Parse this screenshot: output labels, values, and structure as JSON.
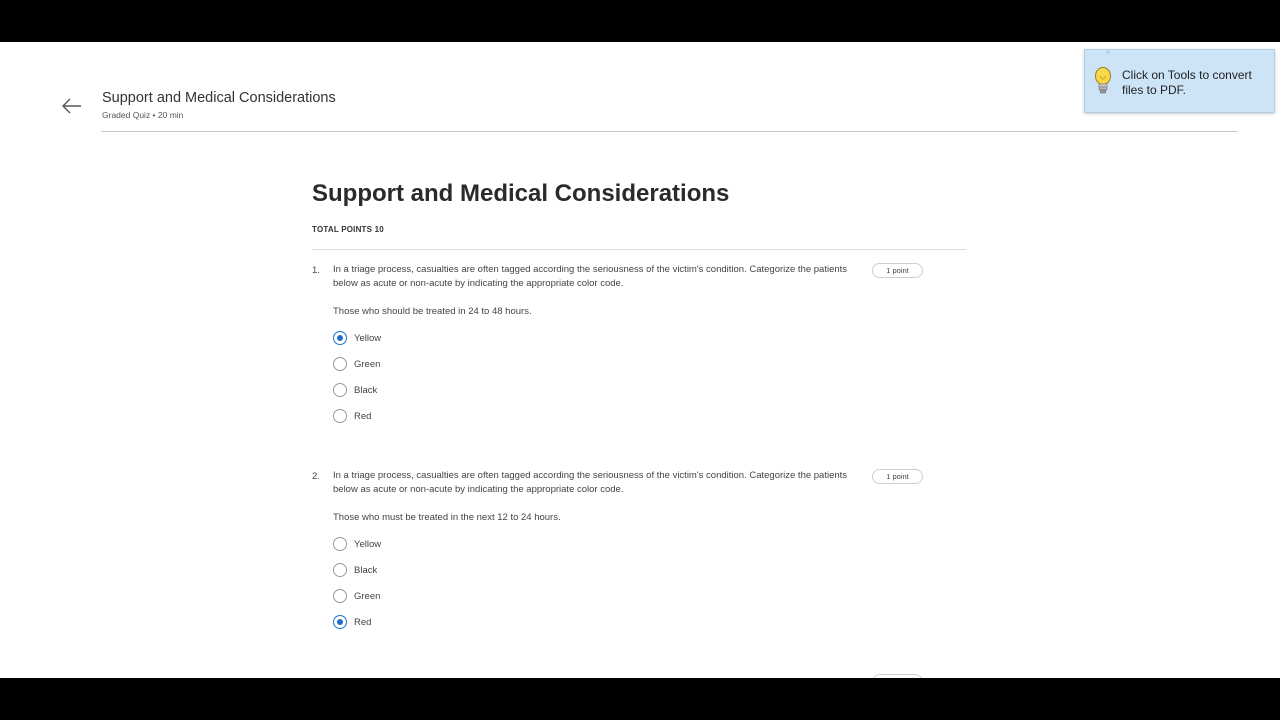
{
  "header": {
    "title": "Support and Medical Considerations",
    "subtitle": "Graded Quiz • 20 min"
  },
  "toast": {
    "message": "Click on Tools to convert files to PDF.",
    "icon": "lightbulb-icon"
  },
  "quiz": {
    "title": "Support and Medical Considerations",
    "total_points": "TOTAL POINTS 10",
    "questions": [
      {
        "number": "1.",
        "text": "In a triage process, casualties are often tagged according the seriousness of the victim's condition. Categorize the patients below as acute or non-acute by indicating the appropriate color code.",
        "points": "1 point",
        "prompt": "Those who should be treated in 24 to 48 hours.",
        "options": [
          {
            "label": "Yellow",
            "selected": true
          },
          {
            "label": "Green",
            "selected": false
          },
          {
            "label": "Black",
            "selected": false
          },
          {
            "label": "Red",
            "selected": false
          }
        ]
      },
      {
        "number": "2.",
        "text": "In a triage process, casualties are often tagged according the seriousness of the victim's condition. Categorize the patients below as acute or non-acute by indicating the appropriate color code.",
        "points": "1 point",
        "prompt": "Those who must be treated in the next 12 to 24 hours.",
        "options": [
          {
            "label": "Yellow",
            "selected": false
          },
          {
            "label": "Black",
            "selected": false
          },
          {
            "label": "Green",
            "selected": false
          },
          {
            "label": "Red",
            "selected": true
          }
        ]
      }
    ]
  },
  "colors": {
    "accent": "#1f6fd1",
    "toast_bg": "#cde4f7"
  }
}
